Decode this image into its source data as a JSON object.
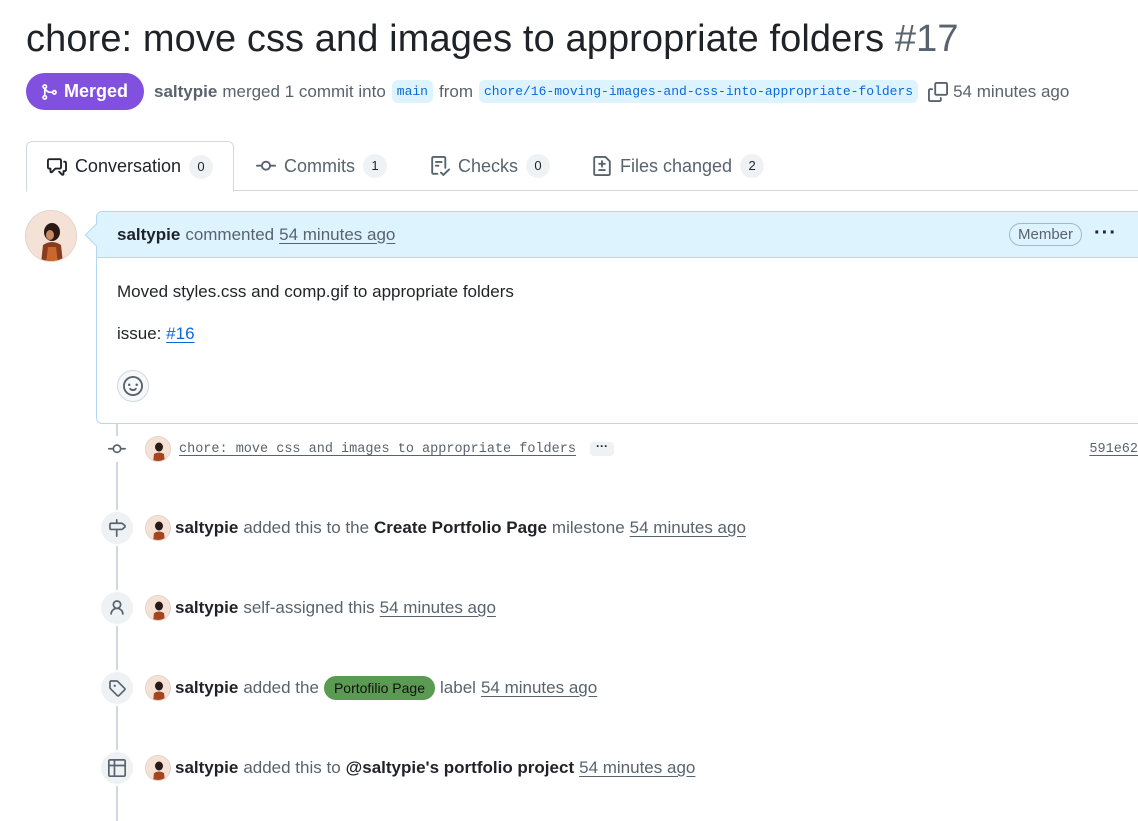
{
  "pr": {
    "title": "chore: move css and images to appropriate folders",
    "number": "#17",
    "state": "Merged",
    "author": "saltypie",
    "merge_text": "merged 1 commit into",
    "base_branch": "main",
    "from_text": "from",
    "head_branch": "chore/16-moving-images-and-css-into-appropriate-folders",
    "time": "54 minutes ago",
    "state_color": "#8250df"
  },
  "tabs": [
    {
      "label": "Conversation",
      "count": "0",
      "icon": "comment-discussion-icon"
    },
    {
      "label": "Commits",
      "count": "1",
      "icon": "git-commit-icon"
    },
    {
      "label": "Checks",
      "count": "0",
      "icon": "checklist-icon"
    },
    {
      "label": "Files changed",
      "count": "2",
      "icon": "file-diff-icon"
    }
  ],
  "comment": {
    "author": "saltypie",
    "action": "commented",
    "time": "54 minutes ago",
    "role": "Member",
    "body_line1": "Moved styles.css and comp.gif to appropriate folders",
    "issue_prefix": "issue:",
    "issue_link": "#16"
  },
  "commit": {
    "message": "chore: move css and images to appropriate folders",
    "sha": "591e62"
  },
  "events": {
    "milestone": {
      "actor": "saltypie",
      "text1": "added this to the",
      "target": "Create Portfolio Page",
      "text2": "milestone",
      "time": "54 minutes ago"
    },
    "assign": {
      "actor": "saltypie",
      "text1": "self-assigned this",
      "time": "54 minutes ago"
    },
    "label": {
      "actor": "saltypie",
      "text1": "added the",
      "label": "Portofilio Page",
      "label_color": "#5a9a52",
      "text2": "label",
      "time": "54 minutes ago"
    },
    "project": {
      "actor": "saltypie",
      "text1": "added this to",
      "target": "@saltypie's portfolio project",
      "time": "54 minutes ago"
    }
  }
}
